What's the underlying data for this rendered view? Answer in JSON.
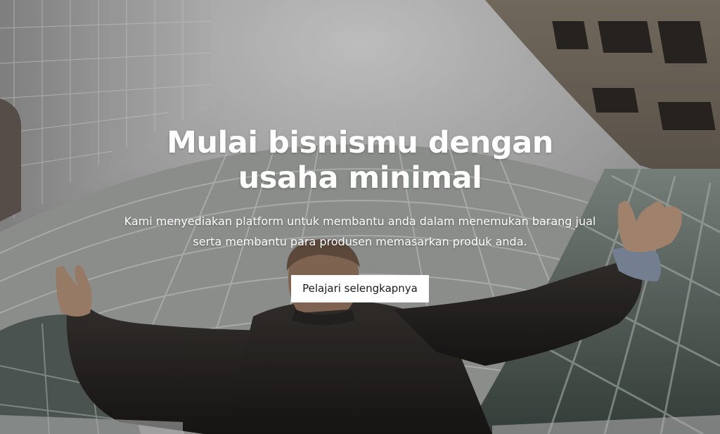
{
  "hero": {
    "title_line1": "Mulai bisnismu dengan",
    "title_line2": "usaha minimal",
    "subtitle_line1": "Kami menyediakan platform untuk membantu anda dalam menemukan barang jual",
    "subtitle_line2": "serta membantu para produsen memasarkan produk anda.",
    "cta_label": "Pelajari selengkapnya"
  }
}
